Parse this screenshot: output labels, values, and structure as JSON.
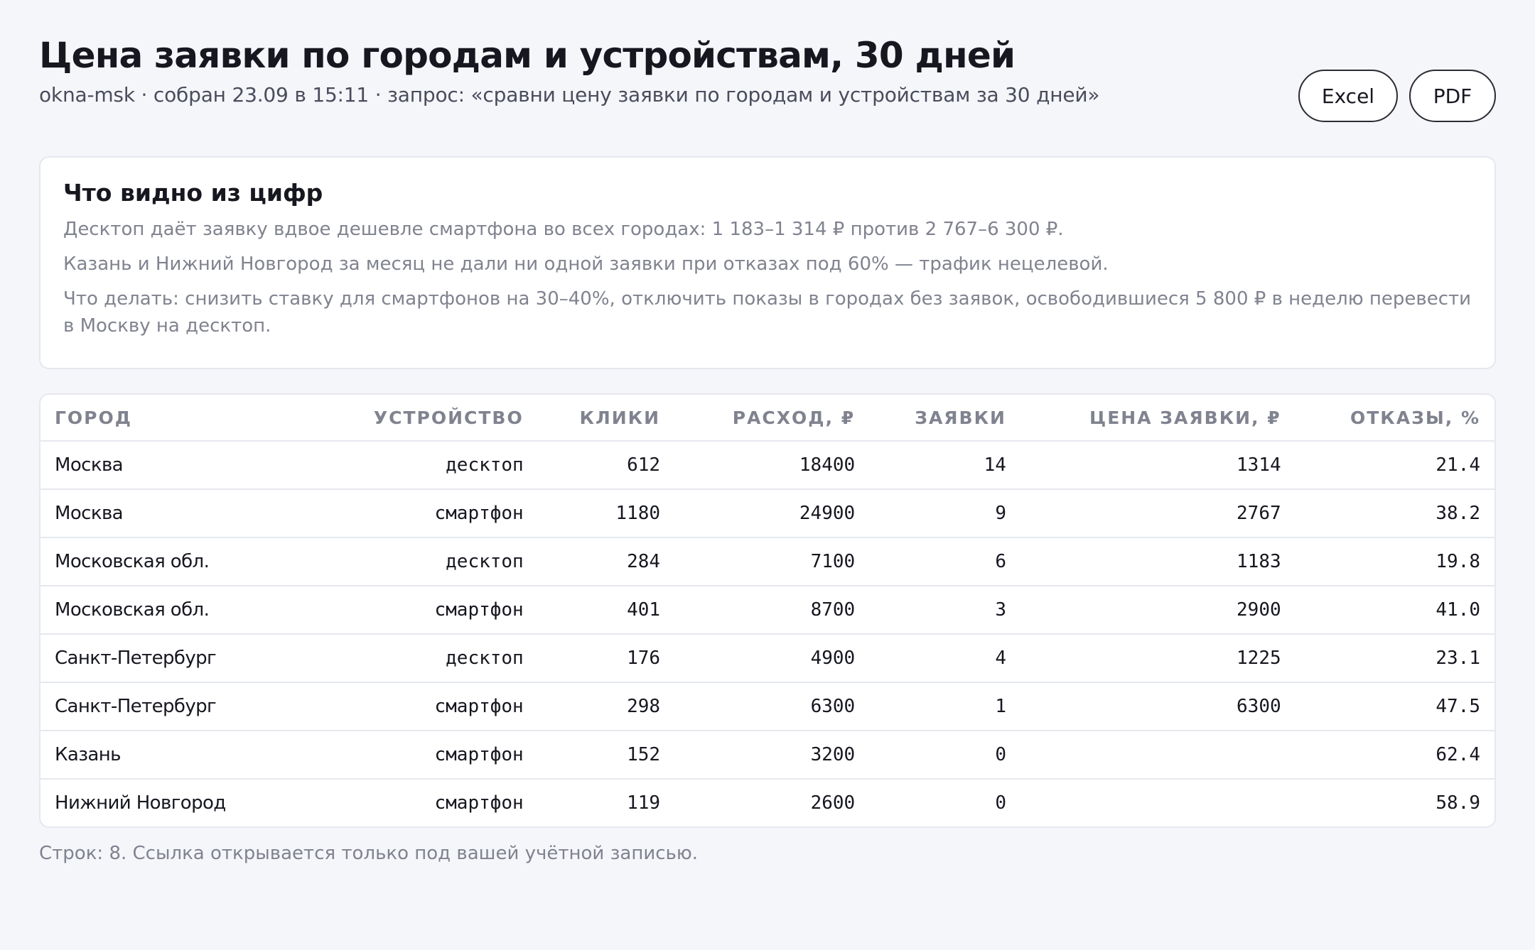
{
  "header": {
    "title": "Цена заявки по городам и устройствам, 30 дней",
    "subtitle": "okna-msk · собран 23.09 в 15:11 · запрос: «сравни цену заявки по городам и устройствам за 30 дней»"
  },
  "actions": {
    "excel_label": "Excel",
    "pdf_label": "PDF"
  },
  "insights": {
    "title": "Что видно из цифр",
    "lines": [
      "Десктоп даёт заявку вдвое дешевле смартфона во всех городах: 1 183–1 314 ₽ против 2 767–6 300 ₽.",
      "Казань и Нижний Новгород за месяц не дали ни одной заявки при отказах под 60% — трафик нецелевой.",
      "Что делать: снизить ставку для смартфонов на 30–40%, отключить показы в городах без заявок, освободившиеся 5 800 ₽ в неделю перевести в Москву на десктоп."
    ]
  },
  "table": {
    "columns": [
      "ГОРОД",
      "УСТРОЙСТВО",
      "КЛИКИ",
      "РАСХОД, ₽",
      "ЗАЯВКИ",
      "ЦЕНА ЗАЯВКИ, ₽",
      "ОТКАЗЫ, %"
    ],
    "rows": [
      [
        "Москва",
        "десктоп",
        "612",
        "18400",
        "14",
        "1314",
        "21.4"
      ],
      [
        "Москва",
        "смартфон",
        "1180",
        "24900",
        "9",
        "2767",
        "38.2"
      ],
      [
        "Московская обл.",
        "десктоп",
        "284",
        "7100",
        "6",
        "1183",
        "19.8"
      ],
      [
        "Московская обл.",
        "смартфон",
        "401",
        "8700",
        "3",
        "2900",
        "41.0"
      ],
      [
        "Санкт-Петербург",
        "десктоп",
        "176",
        "4900",
        "4",
        "1225",
        "23.1"
      ],
      [
        "Санкт-Петербург",
        "смартфон",
        "298",
        "6300",
        "1",
        "6300",
        "47.5"
      ],
      [
        "Казань",
        "смартфон",
        "152",
        "3200",
        "0",
        "",
        "62.4"
      ],
      [
        "Нижний Новгород",
        "смартфон",
        "119",
        "2600",
        "0",
        "",
        "58.9"
      ]
    ]
  },
  "footer": {
    "note": "Строк: 8. Ссылка открывается только под вашей учётной записью."
  }
}
